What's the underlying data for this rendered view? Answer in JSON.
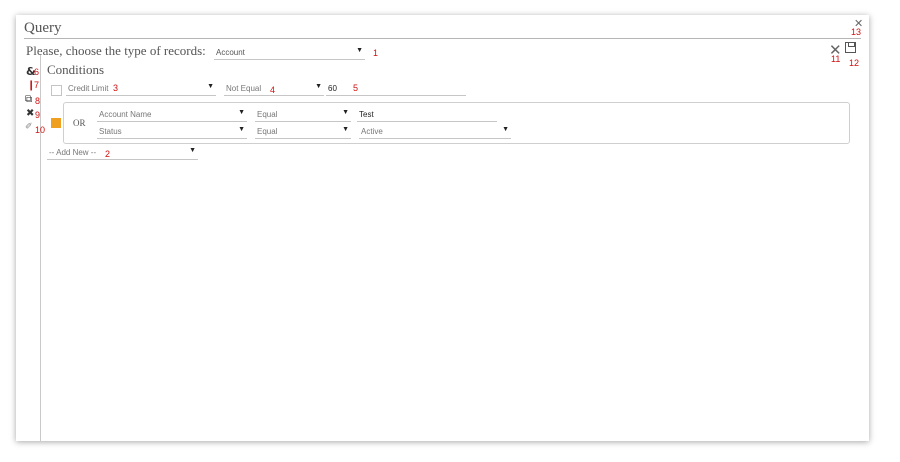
{
  "window": {
    "title": "Query",
    "close_icon_glyph": "✕",
    "close_label_num": "13"
  },
  "header": {
    "choose_label": "Please, choose the type of records:",
    "record_type": "Account",
    "record_type_num": "1",
    "cancel_num": "11",
    "save_num": "12"
  },
  "sidebar": {
    "items": [
      {
        "icon": "and-icon",
        "glyph": "&",
        "num": "6"
      },
      {
        "icon": "or-icon",
        "glyph": "❙",
        "num": "7"
      },
      {
        "icon": "group-icon",
        "glyph": "⧉",
        "num": "8"
      },
      {
        "icon": "delete-icon",
        "glyph": "✖",
        "num": "9"
      },
      {
        "icon": "eraser-icon",
        "glyph": "✐",
        "num": "10"
      }
    ]
  },
  "conditions": {
    "title": "Conditions",
    "rows": [
      {
        "field": "Credit Limit",
        "field_num": "3",
        "operator": "Not Equal",
        "operator_num": "4",
        "value": "60",
        "value_num": "5"
      }
    ],
    "group": {
      "logic": "OR",
      "rows": [
        {
          "field": "Account Name",
          "operator": "Equal",
          "value": "Test"
        },
        {
          "field": "Status",
          "operator": "Equal",
          "value": "Active"
        }
      ]
    },
    "add_new": {
      "label": "-- Add New --",
      "num": "2"
    }
  },
  "colors": {
    "accent": "#f0a020",
    "number_red": "#d01010"
  }
}
